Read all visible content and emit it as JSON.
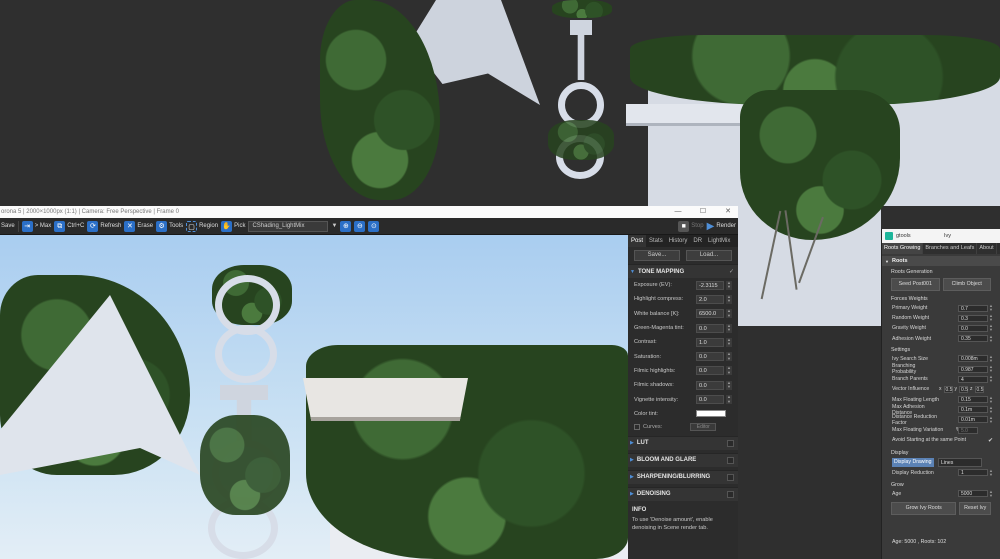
{
  "vfb": {
    "title": "orona 5 | 2000×1000px (1:1) | Camera: Free Perspective | Frame 0",
    "window_controls": {
      "minimize": "—",
      "maximize": "☐",
      "close": "✕"
    },
    "toolbar": {
      "save": "Save",
      "to_max": "> Max",
      "copy": "Ctrl+C",
      "refresh": "Refresh",
      "erase": "Erase",
      "tools": "Tools",
      "region": "Region",
      "pick": "Pick",
      "channel": "CShading_LightMix",
      "stop": "Stop",
      "render": "Render"
    },
    "post": {
      "tabs": [
        "Post",
        "Stats",
        "History",
        "DR",
        "LightMix"
      ],
      "active_tab": "Post",
      "save_label": "Save...",
      "load_label": "Load...",
      "tone_mapping": {
        "title": "TONE MAPPING",
        "rows": [
          {
            "label": "Exposure (EV):",
            "value": "-2.3115"
          },
          {
            "label": "Highlight compress:",
            "value": "2.0"
          },
          {
            "label": "White balance [K]:",
            "value": "6500.0"
          },
          {
            "label": "Green-Magenta tint:",
            "value": "0.0"
          },
          {
            "label": "Contrast:",
            "value": "1.0"
          },
          {
            "label": "Saturation:",
            "value": "0.0"
          },
          {
            "label": "Filmic highlights:",
            "value": "0.0"
          },
          {
            "label": "Filmic shadows:",
            "value": "0.0"
          },
          {
            "label": "Vignette intensity:",
            "value": "0.0"
          }
        ],
        "color_tint_label": "Color tint:",
        "curves_label": "Curves:",
        "curves_edit": "Editor"
      },
      "sections": [
        "LUT",
        "BLOOM AND GLARE",
        "SHARPENING/BLURRING",
        "DENOISING"
      ],
      "info": {
        "title": "INFO",
        "text": "To use 'Denoise amount', enable denoising in Scene render tab."
      }
    }
  },
  "ivy_panel": {
    "app_name": "gtools",
    "title": "Ivy",
    "tabs": [
      "Roots Growing",
      "Branches and Leafs",
      "About"
    ],
    "rollout": "Roots",
    "roots_generation": "Roots Generation",
    "seed_button": "Seed Post001",
    "climb_button": "Climb Object",
    "forces_weights": "Forces Weights",
    "forces": [
      {
        "label": "Primary Weight",
        "value": "0.7"
      },
      {
        "label": "Random Weight",
        "value": "0.3"
      },
      {
        "label": "Gravity Weight",
        "value": "0.0"
      },
      {
        "label": "Adhesion Weight",
        "value": "0.35"
      }
    ],
    "settings": "Settings",
    "settings_rows": [
      {
        "label": "Ivy Search Size",
        "value": "0.008m"
      },
      {
        "label": "Branching Probability",
        "value": "0.987"
      },
      {
        "label": "Branch Parents",
        "value": "4"
      }
    ],
    "vector_influence": {
      "label": "Vector Influence",
      "x": "0.5",
      "y": "0.5",
      "z": "0.5"
    },
    "settings_rows2": [
      {
        "label": "Max Floating Length",
        "value": "0.15"
      },
      {
        "label": "Max Adhesion Distance",
        "value": "0.1m"
      },
      {
        "label": "Distance Reduction Factor",
        "value": "0.01m"
      }
    ],
    "max_float_variation": {
      "label": "Max Floating Variation",
      "pct": "%",
      "value": "5.0"
    },
    "avoid_label": "Avoid Starting at the same Point",
    "display": "Display",
    "display_drawing": "Display Drawing",
    "display_mode": "Lines",
    "display_reduction": {
      "label": "Display Reduction",
      "value": "1"
    },
    "grow": "Grow",
    "age": {
      "label": "Age",
      "value": "5000"
    },
    "grow_button": "Grow Ivy Roots",
    "reset_button": "Reset Ivy",
    "status": "Age: 5000 , Roots: 102"
  },
  "colors": {
    "accent": "#2b6fc7",
    "sky": "#a9cdf0",
    "ivy": "#2e5227",
    "wall": "#cfd5df"
  }
}
